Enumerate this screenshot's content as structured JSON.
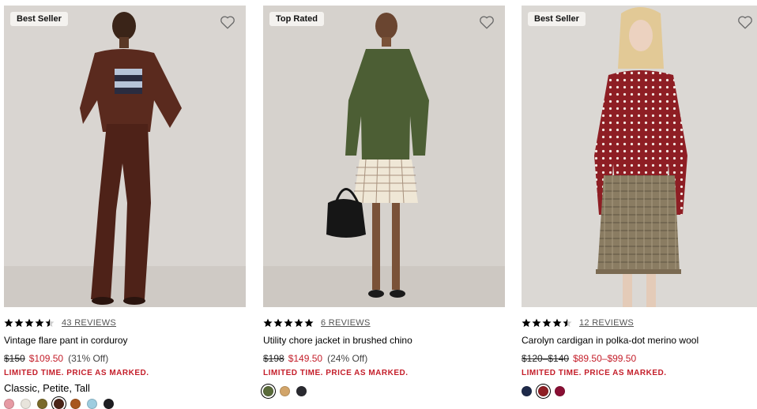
{
  "products": [
    {
      "badge": "Best Seller",
      "wishlist_icon": "heart-outline-icon",
      "rating": 4.5,
      "reviews": "43 REVIEWS",
      "name": "Vintage flare pant in corduroy",
      "was_price": "$150",
      "sale_price": "$109.50",
      "discount": "(31% Off)",
      "promo": "LIMITED TIME. PRICE AS MARKED.",
      "fits": "Classic, Petite, Tall",
      "swatches": [
        "#e69aa4",
        "#e8e4dc",
        "#7a6a2a",
        "#4a2418",
        "#a8571f",
        "#9ecde0",
        "#1e1e22"
      ],
      "selected_swatch": 3
    },
    {
      "badge": "Top Rated",
      "wishlist_icon": "heart-outline-icon",
      "rating": 5,
      "reviews": "6 REVIEWS",
      "name": "Utility chore jacket in brushed chino",
      "was_price": "$198",
      "sale_price": "$149.50",
      "discount": "(24% Off)",
      "promo": "LIMITED TIME. PRICE AS MARKED.",
      "fits": "",
      "swatches": [
        "#5a6b3a",
        "#d2a56a",
        "#2a2a30"
      ],
      "selected_swatch": 0
    },
    {
      "badge": "Best Seller",
      "wishlist_icon": "heart-outline-icon",
      "rating": 4.5,
      "reviews": "12 REVIEWS",
      "name": "Carolyn cardigan in polka-dot merino wool",
      "was_price": "$120–$140",
      "sale_price": "$89.50–$99.50",
      "discount": "",
      "promo": "LIMITED TIME. PRICE AS MARKED.",
      "fits": "",
      "swatches": [
        "#1e2a4a",
        "#8e1e24",
        "#8a0f34"
      ],
      "selected_swatch": 1
    }
  ],
  "colors": {
    "sale_red": "#c41e2a",
    "image_bg": "#dcd8d4"
  }
}
